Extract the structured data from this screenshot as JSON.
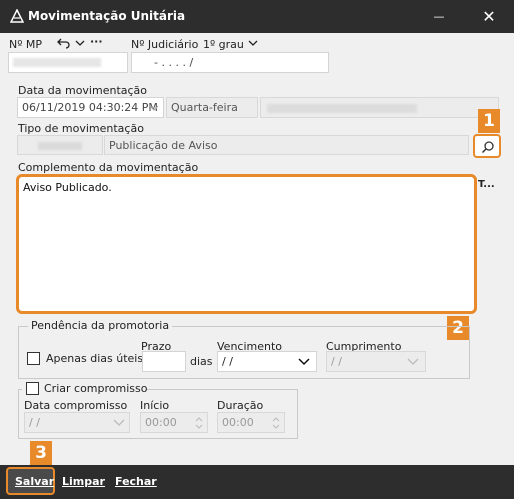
{
  "window": {
    "title": "Movimentação Unitária",
    "minimize_glyph": "—",
    "close_glyph": "✕"
  },
  "header": {
    "np_mp_label": "Nº MP",
    "nr_judiciario_label": "Nº Judiciário",
    "grau_value": "1º grau",
    "judiciario_value": "-  .   . . .   /",
    "more_glyph": "···"
  },
  "form": {
    "data_label": "Data da movimentação",
    "data_value": "06/11/2019 04:30:24 PM",
    "weekday_value": "Quarta-feira",
    "tipo_label": "Tipo de movimentação",
    "tipo_value": "Publicação de Aviso",
    "complemento_label": "Complemento da movimentação",
    "complemento_value": "Aviso Publicado.",
    "overflow_marker": "T..."
  },
  "pendencia": {
    "group_title": "Pendência da promotoria",
    "apenas_dias_uteis_label": "Apenas dias úteis?",
    "prazo_label": "Prazo",
    "dias_label": "dias",
    "vencimento_label": "Vencimento",
    "vencimento_value": " / /",
    "cumprimento_label": "Cumprimento",
    "cumprimento_value": " / /"
  },
  "compromisso": {
    "criar_label": "Criar compromisso",
    "data_label": "Data compromisso",
    "data_value": " / /",
    "inicio_label": "Início",
    "inicio_value": "00:00",
    "duracao_label": "Duração",
    "duracao_value": "00:00"
  },
  "annotations": {
    "badge_1": "1",
    "badge_2": "2",
    "badge_3": "3",
    "accent": "#e8892a"
  },
  "footer": {
    "salvar": "Salvar",
    "limpar": "Limpar",
    "fechar": "Fechar"
  }
}
